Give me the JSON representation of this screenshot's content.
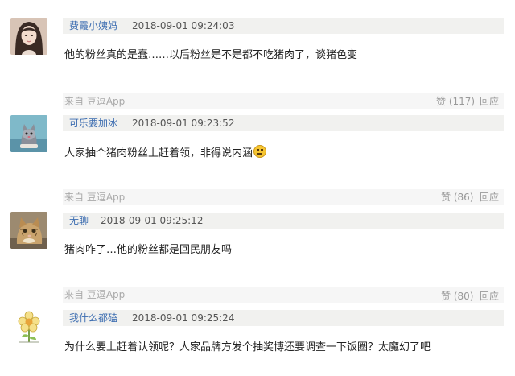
{
  "comments": [
    {
      "author": "费霞小姨妈",
      "time": "2018-09-01 09:24:03",
      "text": "他的粉丝真的是蠢……以后粉丝是不是都不吃猪肉了，谈猪色变",
      "source": "来自 豆逗App",
      "likes": "赞 (117)",
      "reply": "回应"
    },
    {
      "author": "可乐要加冰",
      "time": "2018-09-01 09:23:52",
      "text": "人家抽个猪肉粉丝上赶着领，非得说内涵",
      "source": "来自 豆逗App",
      "likes": "赞 (86)",
      "reply": "回应"
    },
    {
      "author": "无聊",
      "time": "2018-09-01 09:25:12",
      "text": "猪肉咋了…他的粉丝都是回民朋友吗",
      "source": "来自 豆逗App",
      "likes": "赞 (80)",
      "reply": "回应"
    },
    {
      "author": "我什么都磕",
      "time": "2018-09-01 09:25:24",
      "text": "为什么要上赶着认领呢？人家品牌方发个抽奖博还要调查一下饭圈？太魔幻了吧"
    }
  ],
  "colors": {
    "author_link": "#3b6cb0",
    "header_band": "#f1f1ef",
    "muted": "#999999"
  },
  "icons": {
    "avatar_1": "girl-portrait-avatar",
    "avatar_2": "cartoon-cat-avatar",
    "avatar_3": "cat-photo-avatar",
    "avatar_4": "flower-doodle-avatar",
    "emoji": "smirk-emoji-icon"
  }
}
